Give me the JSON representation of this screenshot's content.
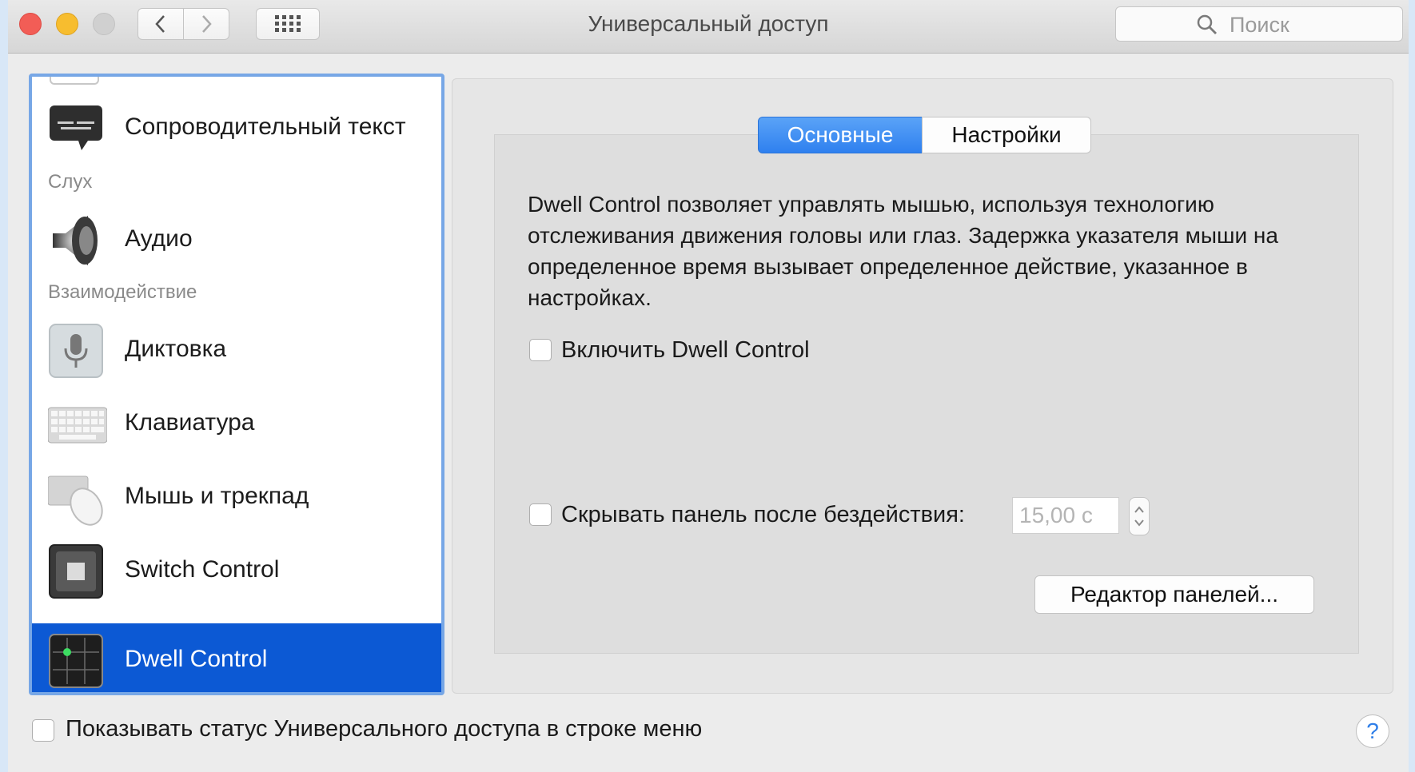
{
  "window": {
    "title": "Универсальный доступ",
    "search_placeholder": "Поиск"
  },
  "sidebar": {
    "items": [
      {
        "label": "Сопроводительный текст",
        "icon": "captions-icon"
      },
      {
        "section": "Слух"
      },
      {
        "label": "Аудио",
        "icon": "speaker-icon"
      },
      {
        "section": "Взаимодействие"
      },
      {
        "label": "Диктовка",
        "icon": "microphone-icon"
      },
      {
        "label": "Клавиатура",
        "icon": "keyboard-icon"
      },
      {
        "label": "Мышь и трекпад",
        "icon": "mouse-icon"
      },
      {
        "label": "Switch Control",
        "icon": "switch-control-icon"
      },
      {
        "label": "Dwell Control",
        "icon": "dwell-control-icon",
        "selected": true
      }
    ]
  },
  "tabs": [
    {
      "label": "Основные",
      "active": true
    },
    {
      "label": "Настройки",
      "active": false
    }
  ],
  "main": {
    "description": "Dwell Control позволяет управлять мышью, используя технологию отслеживания движения головы или глаз. Задержка указателя мыши на определенное время вызывает определенное действие, указанное в настройках.",
    "enable_checkbox": {
      "label": "Включить Dwell Control",
      "checked": false
    },
    "hide_checkbox": {
      "label": "Скрывать панель после бездействия:",
      "checked": false
    },
    "hide_delay_value": "15,00 с",
    "editor_button": "Редактор панелей..."
  },
  "footer": {
    "status_checkbox": {
      "label": "Показывать статус Универсального доступа в строке меню",
      "checked": false
    },
    "help_label": "?"
  },
  "colors": {
    "selection": "#0c59d4",
    "segment_active": "#2f80ef",
    "close": "#f25d56",
    "minimize": "#f7bd2f"
  }
}
